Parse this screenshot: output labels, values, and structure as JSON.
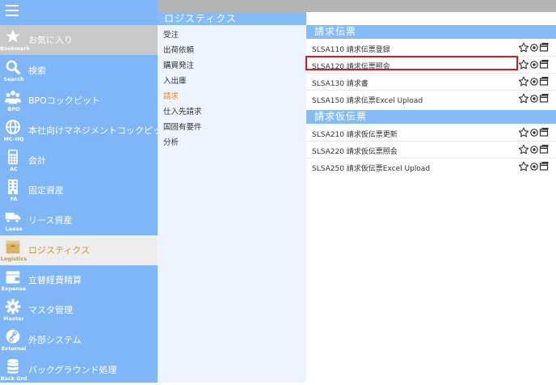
{
  "sidebar": {
    "items": [
      {
        "label": "お気に入り",
        "caption": "Bookmark",
        "icon": "star-icon"
      },
      {
        "label": "検索",
        "caption": "Search",
        "icon": "search-icon"
      },
      {
        "label": "BPOコックピット",
        "caption": "BPO",
        "icon": "people-icon"
      },
      {
        "label": "本社向けマネジメントコックピット",
        "caption": "MC-HQ",
        "icon": "globe-icon"
      },
      {
        "label": "会計",
        "caption": "AC",
        "icon": "calculator-icon"
      },
      {
        "label": "固定資産",
        "caption": "FA",
        "icon": "building-icon"
      },
      {
        "label": "リース資産",
        "caption": "Lease",
        "icon": "truck-icon"
      },
      {
        "label": "ロジスティクス",
        "caption": "Logistics",
        "icon": "box-icon"
      },
      {
        "label": "立替経費精算",
        "caption": "Expense",
        "icon": "wallet-icon"
      },
      {
        "label": "マスタ管理",
        "caption": "Master",
        "icon": "gear-icon"
      },
      {
        "label": "外部システム",
        "caption": "External",
        "icon": "link-icon"
      },
      {
        "label": "バックグラウンド処理",
        "caption": "Back Grd",
        "icon": "database-icon"
      }
    ]
  },
  "middle": {
    "title": "ロジスティクス",
    "items": [
      "受注",
      "出荷依頼",
      "購買発注",
      "入出庫",
      "請求",
      "仕入先請求",
      "国固有要件",
      "分析"
    ]
  },
  "content": {
    "sections": [
      {
        "title": "請求伝票",
        "rows": [
          "SLSA110 請求伝票登録",
          "SLSA120 請求伝票照会",
          "SLSA130 請求書",
          "SLSA150 請求伝票Excel Upload"
        ]
      },
      {
        "title": "請求仮伝票",
        "rows": [
          "SLSA210 請求仮伝票更新",
          "SLSA220 請求仮伝票照会",
          "SLSA250 請求仮伝票Excel Upload"
        ]
      }
    ],
    "row_actions": [
      "star-outline-icon",
      "circle-target-icon",
      "window-icon"
    ]
  },
  "colors": {
    "sidebar": "#7eb6f8",
    "header_blue": "#84bcf8",
    "active_text": "#e38a24",
    "highlight": "#e2131c"
  }
}
